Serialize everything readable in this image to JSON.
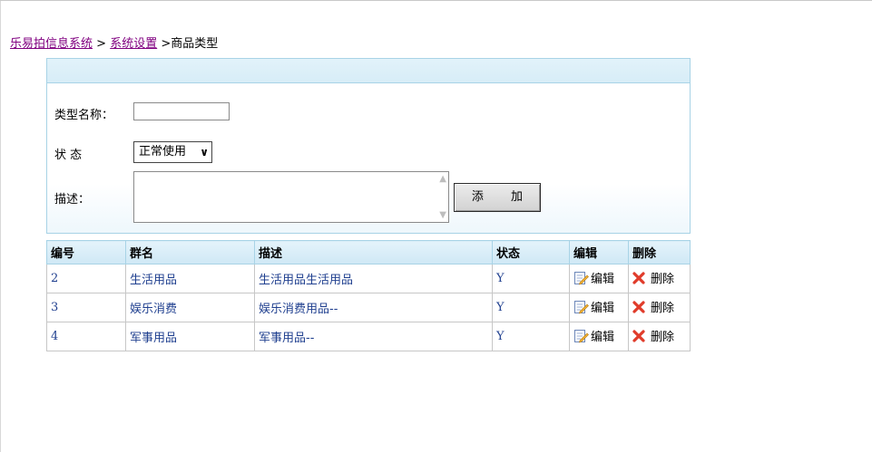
{
  "breadcrumb": {
    "items": [
      "乐易拍信息系统",
      "系统设置",
      "商品类型"
    ],
    "separator": ">"
  },
  "form": {
    "name_label": "类型名称：",
    "name_value": "",
    "status_label": "状 态",
    "status_selected": "正常使用",
    "desc_label": "描述：",
    "desc_value": "",
    "add_button": "添 加"
  },
  "table": {
    "headers": [
      "编号",
      "群名",
      "描述",
      "状态",
      "编辑",
      "删除"
    ],
    "rows": [
      {
        "id": "2",
        "name": "生活用品",
        "desc": "生活用品生活用品",
        "status": "Y",
        "edit": "编辑",
        "delete": "删除"
      },
      {
        "id": "3",
        "name": "娱乐消费",
        "desc": "娱乐消费用品--",
        "status": "Y",
        "edit": "编辑",
        "delete": "删除"
      },
      {
        "id": "4",
        "name": "军事用品",
        "desc": "军事用品--",
        "status": "Y",
        "edit": "编辑",
        "delete": "删除"
      }
    ]
  },
  "icons": {
    "edit": "edit-icon",
    "delete": "delete-icon",
    "select": "chevron-down-icon"
  },
  "colors": {
    "link": "#800080",
    "cell_text": "#1f3f8f",
    "header_bg": "#d7edf7",
    "delete_x": "#e03b2a"
  }
}
